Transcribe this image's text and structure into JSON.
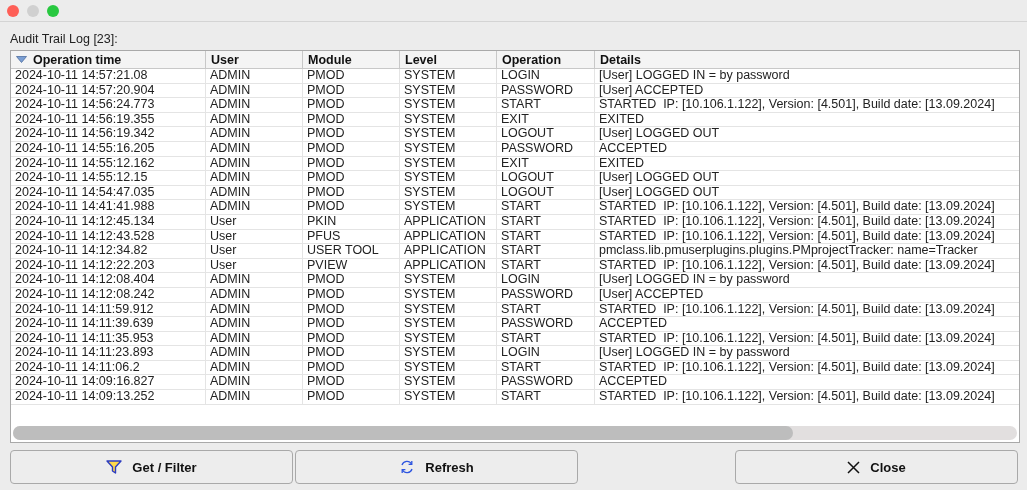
{
  "log_label": "Audit Trail Log [23]:",
  "table": {
    "columns": [
      {
        "label": "Operation time",
        "sorted": true
      },
      {
        "label": "User",
        "sorted": false
      },
      {
        "label": "Module",
        "sorted": false
      },
      {
        "label": "Level",
        "sorted": false
      },
      {
        "label": "Operation",
        "sorted": false
      },
      {
        "label": "Details",
        "sorted": false
      }
    ],
    "rows": [
      [
        "2024-10-11 14:57:21.08",
        "ADMIN",
        "PMOD",
        "SYSTEM",
        "LOGIN",
        "[User] LOGGED IN = by password"
      ],
      [
        "2024-10-11 14:57:20.904",
        "ADMIN",
        "PMOD",
        "SYSTEM",
        "PASSWORD",
        "[User] ACCEPTED"
      ],
      [
        "2024-10-11 14:56:24.773",
        "ADMIN",
        "PMOD",
        "SYSTEM",
        "START",
        "STARTED  IP: [10.106.1.122], Version: [4.501], Build date: [13.09.2024]"
      ],
      [
        "2024-10-11 14:56:19.355",
        "ADMIN",
        "PMOD",
        "SYSTEM",
        "EXIT",
        "EXITED"
      ],
      [
        "2024-10-11 14:56:19.342",
        "ADMIN",
        "PMOD",
        "SYSTEM",
        "LOGOUT",
        "[User] LOGGED OUT"
      ],
      [
        "2024-10-11 14:55:16.205",
        "ADMIN",
        "PMOD",
        "SYSTEM",
        "PASSWORD",
        "ACCEPTED"
      ],
      [
        "2024-10-11 14:55:12.162",
        "ADMIN",
        "PMOD",
        "SYSTEM",
        "EXIT",
        "EXITED"
      ],
      [
        "2024-10-11 14:55:12.15",
        "ADMIN",
        "PMOD",
        "SYSTEM",
        "LOGOUT",
        "[User] LOGGED OUT"
      ],
      [
        "2024-10-11 14:54:47.035",
        "ADMIN",
        "PMOD",
        "SYSTEM",
        "LOGOUT",
        "[User] LOGGED OUT"
      ],
      [
        "2024-10-11 14:41:41.988",
        "ADMIN",
        "PMOD",
        "SYSTEM",
        "START",
        "STARTED  IP: [10.106.1.122], Version: [4.501], Build date: [13.09.2024]"
      ],
      [
        "2024-10-11 14:12:45.134",
        "User",
        "PKIN",
        "APPLICATION",
        "START",
        "STARTED  IP: [10.106.1.122], Version: [4.501], Build date: [13.09.2024]"
      ],
      [
        "2024-10-11 14:12:43.528",
        "User",
        "PFUS",
        "APPLICATION",
        "START",
        "STARTED  IP: [10.106.1.122], Version: [4.501], Build date: [13.09.2024]"
      ],
      [
        "2024-10-11 14:12:34.82",
        "User",
        "USER TOOL",
        "APPLICATION",
        "START",
        "pmclass.lib.pmuserplugins.plugins.PMprojectTracker: name=Tracker"
      ],
      [
        "2024-10-11 14:12:22.203",
        "User",
        "PVIEW",
        "APPLICATION",
        "START",
        "STARTED  IP: [10.106.1.122], Version: [4.501], Build date: [13.09.2024]"
      ],
      [
        "2024-10-11 14:12:08.404",
        "ADMIN",
        "PMOD",
        "SYSTEM",
        "LOGIN",
        "[User] LOGGED IN = by password"
      ],
      [
        "2024-10-11 14:12:08.242",
        "ADMIN",
        "PMOD",
        "SYSTEM",
        "PASSWORD",
        "[User] ACCEPTED"
      ],
      [
        "2024-10-11 14:11:59.912",
        "ADMIN",
        "PMOD",
        "SYSTEM",
        "START",
        "STARTED  IP: [10.106.1.122], Version: [4.501], Build date: [13.09.2024]"
      ],
      [
        "2024-10-11 14:11:39.639",
        "ADMIN",
        "PMOD",
        "SYSTEM",
        "PASSWORD",
        "ACCEPTED"
      ],
      [
        "2024-10-11 14:11:35.953",
        "ADMIN",
        "PMOD",
        "SYSTEM",
        "START",
        "STARTED  IP: [10.106.1.122], Version: [4.501], Build date: [13.09.2024]"
      ],
      [
        "2024-10-11 14:11:23.893",
        "ADMIN",
        "PMOD",
        "SYSTEM",
        "LOGIN",
        "[User] LOGGED IN = by password"
      ],
      [
        "2024-10-11 14:11:06.2",
        "ADMIN",
        "PMOD",
        "SYSTEM",
        "START",
        "STARTED  IP: [10.106.1.122], Version: [4.501], Build date: [13.09.2024]"
      ],
      [
        "2024-10-11 14:09:16.827",
        "ADMIN",
        "PMOD",
        "SYSTEM",
        "PASSWORD",
        "ACCEPTED"
      ],
      [
        "2024-10-11 14:09:13.252",
        "ADMIN",
        "PMOD",
        "SYSTEM",
        "START",
        "STARTED  IP: [10.106.1.122], Version: [4.501], Build date: [13.09.2024]"
      ]
    ]
  },
  "buttons": [
    {
      "kind": "filter",
      "label": "Get / Filter"
    },
    {
      "kind": "refresh",
      "label": "Refresh"
    },
    {
      "kind": "close",
      "label": "Close"
    }
  ]
}
